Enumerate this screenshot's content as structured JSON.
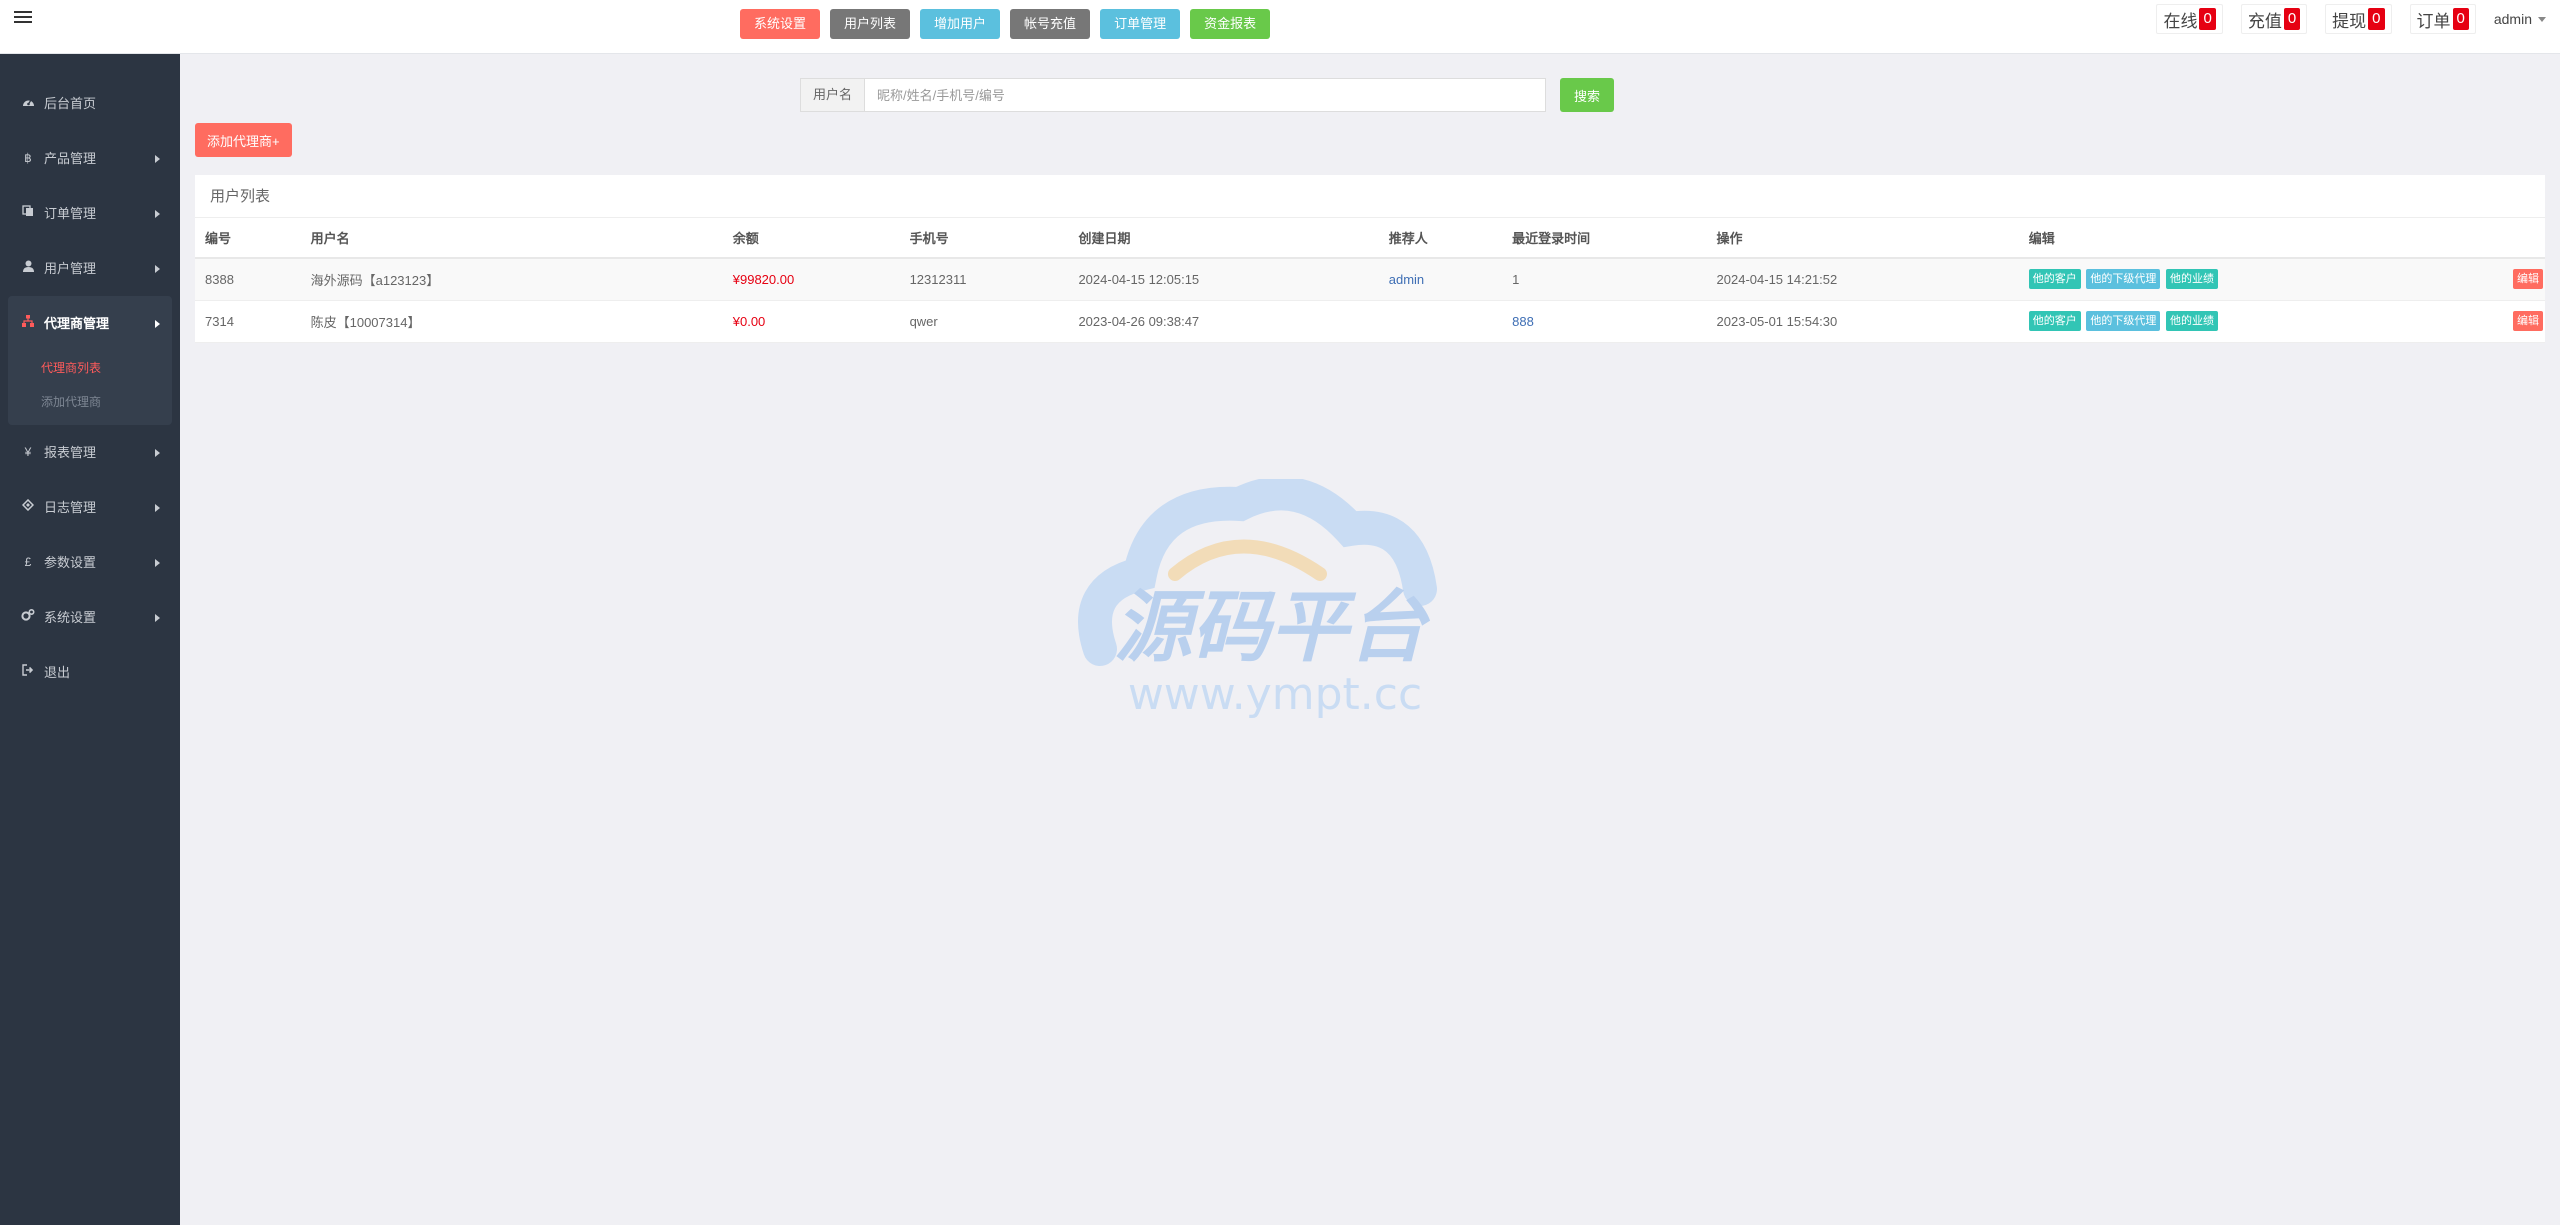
{
  "header": {
    "quick_nav": [
      {
        "label": "系统设置",
        "color": "#ff6c60"
      },
      {
        "label": "用户列表",
        "color": "#777777"
      },
      {
        "label": "增加用户",
        "color": "#5bc0de"
      },
      {
        "label": "帐号充值",
        "color": "#777777"
      },
      {
        "label": "订单管理",
        "color": "#5bc0de"
      },
      {
        "label": "资金报表",
        "color": "#69c94a"
      }
    ],
    "stats": [
      {
        "label": "在线",
        "count": "0"
      },
      {
        "label": "充值",
        "count": "0"
      },
      {
        "label": "提现",
        "count": "0"
      },
      {
        "label": "订单",
        "count": "0"
      }
    ],
    "user": "admin"
  },
  "sidebar": {
    "items": [
      {
        "label": "后台首页",
        "icon": "dashboard-icon"
      },
      {
        "label": "产品管理",
        "icon": "bitcoin-icon"
      },
      {
        "label": "订单管理",
        "icon": "copy-icon"
      },
      {
        "label": "用户管理",
        "icon": "user-icon"
      },
      {
        "label": "代理商管理",
        "icon": "sitemap-icon"
      },
      {
        "label": "报表管理",
        "icon": "yen-icon"
      },
      {
        "label": "日志管理",
        "icon": "ticket-icon"
      },
      {
        "label": "参数设置",
        "icon": "gbp-icon"
      },
      {
        "label": "系统设置",
        "icon": "gears-icon"
      },
      {
        "label": "退出",
        "icon": "sign-out-icon"
      }
    ],
    "agent_sub": [
      {
        "label": "代理商列表"
      },
      {
        "label": "添加代理商"
      }
    ]
  },
  "search": {
    "label": "用户名",
    "placeholder": "昵称/姓名/手机号/编号",
    "button": "搜索"
  },
  "add_agent_label": "添加代理商+",
  "panel_title": "用户列表",
  "table": {
    "columns": [
      "编号",
      "用户名",
      "余额",
      "手机号",
      "创建日期",
      "推荐人",
      "最近登录时间",
      "操作",
      "编辑"
    ],
    "rows": [
      {
        "id": "8388",
        "username": "海外源码【a123123】",
        "balance": "¥99820.00",
        "phone": "12312311",
        "created": "2024-04-15 12:05:15",
        "referrer": "admin",
        "last_login": "1",
        "operation": "2024-04-15 14:21:52"
      },
      {
        "id": "7314",
        "username": "陈皮【10007314】",
        "balance": "¥0.00",
        "phone": "qwer",
        "created": "2023-04-26 09:38:47",
        "referrer": "",
        "last_login": "888",
        "operation": "2023-05-01 15:54:30"
      }
    ],
    "tag_labels": {
      "customers": "他的客户",
      "sub_agents": "他的下级代理",
      "performance": "他的业绩",
      "edit": "编辑"
    }
  },
  "watermark": {
    "title": "源码平台",
    "url": "www.ympt.cc"
  }
}
